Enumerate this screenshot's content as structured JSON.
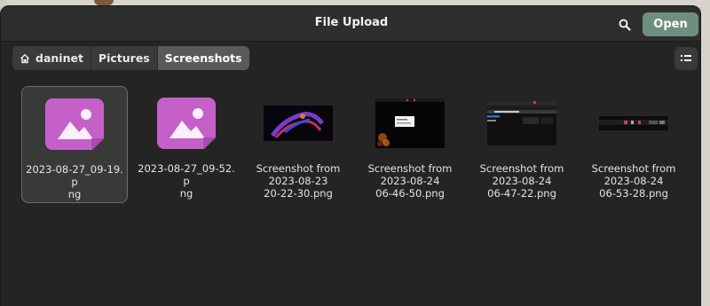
{
  "window": {
    "title": "File Upload",
    "open_label": "Open",
    "search_icon": "search-icon",
    "view_icon": "list-view-icon"
  },
  "pathbar": {
    "items": [
      {
        "label": "daninet",
        "icon": "home-icon",
        "active": false
      },
      {
        "label": "Pictures",
        "active": false
      },
      {
        "label": "Screenshots",
        "active": true
      }
    ]
  },
  "files": [
    {
      "name": "2023-08-27_09-19.png",
      "name_lines": [
        "2023-08-27_09-19.p",
        "ng"
      ],
      "thumbnail": "image-file-icon",
      "selected": true
    },
    {
      "name": "2023-08-27_09-52.png",
      "name_lines": [
        "2023-08-27_09-52.p",
        "ng"
      ],
      "thumbnail": "image-file-icon",
      "selected": false
    },
    {
      "name": "Screenshot from 2023-08-23 20-22-30.png",
      "name_lines": [
        "Screenshot from",
        "2023-08-23",
        "20-22-30.png"
      ],
      "thumbnail": "screenshot-thumbnail",
      "selected": false
    },
    {
      "name": "Screenshot from 2023-08-24 06-46-50.png",
      "name_lines": [
        "Screenshot from",
        "2023-08-24",
        "06-46-50.png"
      ],
      "thumbnail": "screenshot-thumbnail",
      "selected": false
    },
    {
      "name": "Screenshot from 2023-08-24 06-47-22.png",
      "name_lines": [
        "Screenshot from",
        "2023-08-24",
        "06-47-22.png"
      ],
      "thumbnail": "screenshot-thumbnail",
      "selected": false
    },
    {
      "name": "Screenshot from 2023-08-24 06-53-28.png",
      "name_lines": [
        "Screenshot from",
        "2023-08-24",
        "06-53-28.png"
      ],
      "thumbnail": "screenshot-thumbnail",
      "selected": false
    }
  ],
  "colors": {
    "accent_open": "#6e8f7e",
    "image_icon": "#c560c9",
    "dialog_bg": "#242424"
  }
}
